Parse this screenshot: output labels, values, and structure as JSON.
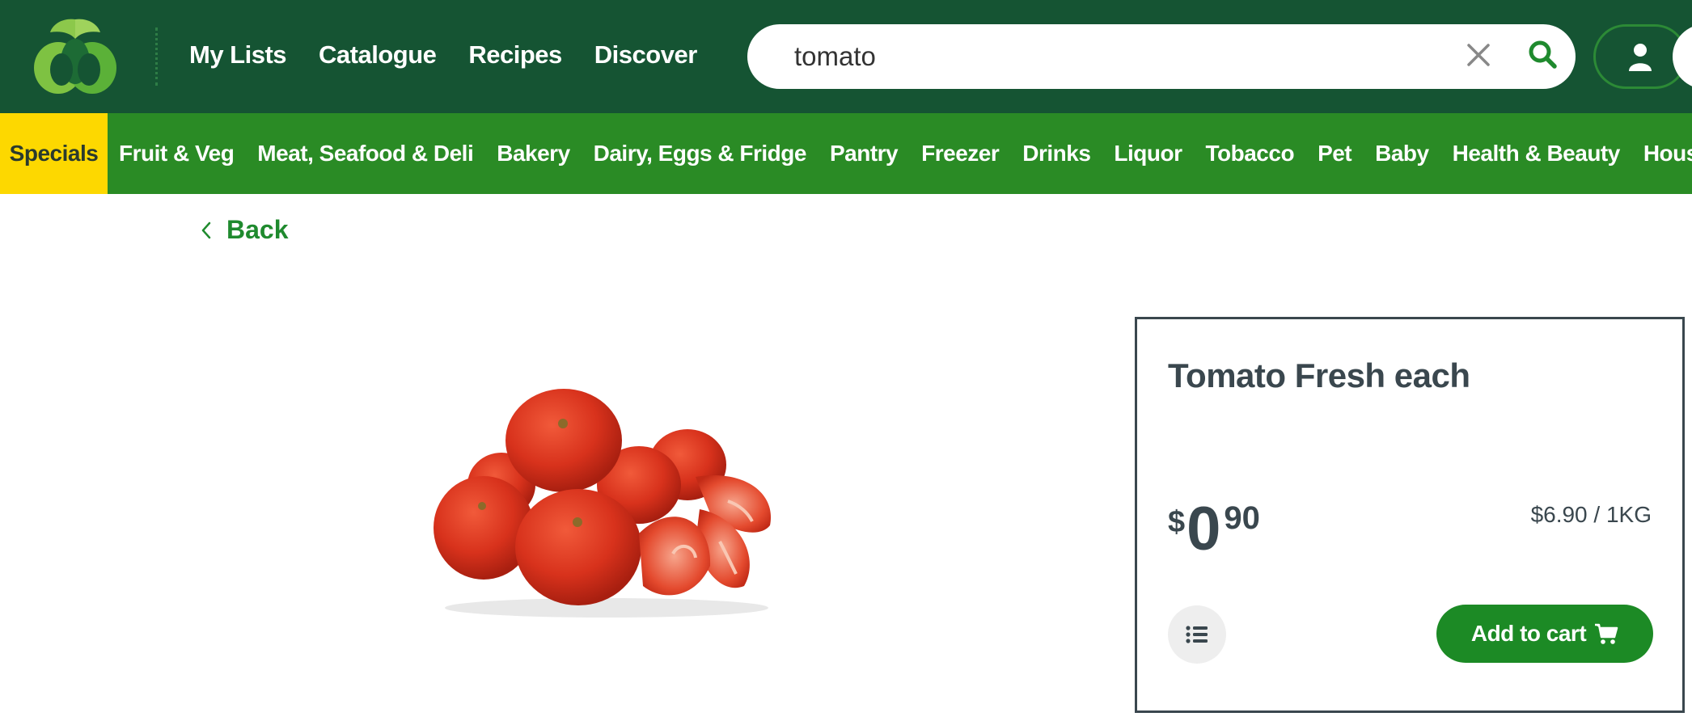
{
  "header": {
    "nav": [
      "My Lists",
      "Catalogue",
      "Recipes",
      "Discover"
    ],
    "search": {
      "value": "tomato",
      "placeholder": ""
    },
    "icons": {
      "logo": "woolworths-logo",
      "clear": "close-icon",
      "search": "search-icon",
      "account": "user-icon"
    }
  },
  "categories": {
    "specials": "Specials",
    "items": [
      "Fruit & Veg",
      "Meat, Seafood & Deli",
      "Bakery",
      "Dairy, Eggs & Fridge",
      "Pantry",
      "Freezer",
      "Drinks",
      "Liquor",
      "Tobacco",
      "Pet",
      "Baby",
      "Health & Beauty",
      "Household"
    ]
  },
  "back_label": "Back",
  "product": {
    "name": "Tomato Fresh each",
    "price": {
      "currency": "$",
      "whole": "0",
      "cents": "90"
    },
    "unit_price": "$6.90 / 1KG",
    "add_to_cart": "Add to cart"
  },
  "colors": {
    "header_bg": "#155433",
    "category_bg": "#2a8b25",
    "specials_bg": "#fdd800",
    "accent_green": "#1c8a25",
    "text": "#3a474e"
  }
}
